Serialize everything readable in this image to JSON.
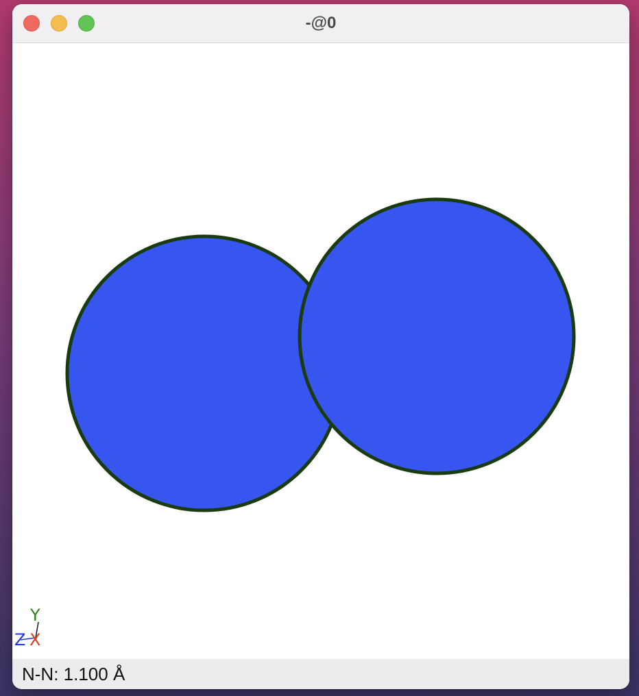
{
  "window": {
    "title": "-@0"
  },
  "viewer": {
    "atoms": [
      {
        "element": "N",
        "color": "#3656ef",
        "outline": "#1a3a10"
      },
      {
        "element": "N",
        "color": "#3656ef",
        "outline": "#1a3a10"
      }
    ],
    "axes": {
      "y_label": "Y",
      "z_label": "Z",
      "x_label": "X",
      "y_color": "#2e7d1e",
      "z_color": "#1f36e0",
      "x_color": "#e03a1f"
    }
  },
  "status": {
    "text": "N-N: 1.100 Å"
  }
}
